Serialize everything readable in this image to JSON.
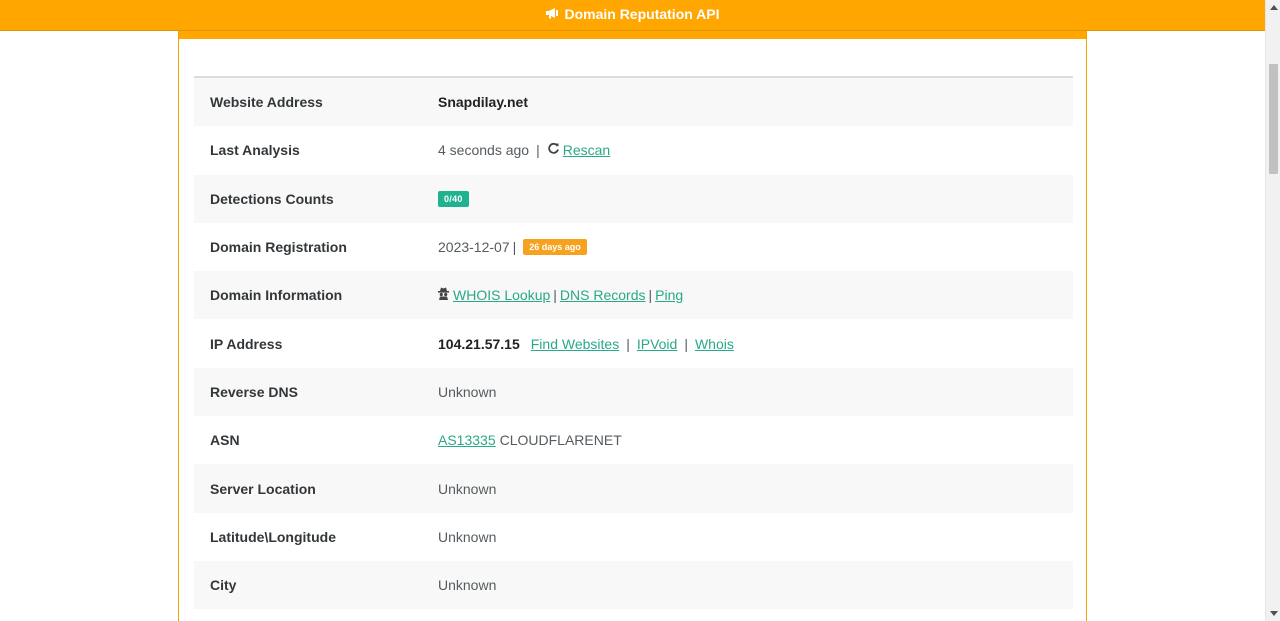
{
  "header": {
    "title": "Domain Reputation API",
    "icon": "megaphone-icon",
    "color": "#ffa600"
  },
  "rows": {
    "website_address": {
      "label": "Website Address",
      "value": "Snapdilay.net"
    },
    "last_analysis": {
      "label": "Last Analysis",
      "value": "4 seconds ago",
      "separator": "|",
      "rescan": "Rescan"
    },
    "detections": {
      "label": "Detections Counts",
      "badge": "0/40"
    },
    "registration": {
      "label": "Domain Registration",
      "date": "2023-12-07",
      "separator": "|",
      "badge": "26 days ago"
    },
    "information": {
      "label": "Domain Information",
      "whois": "WHOIS Lookup",
      "dns": "DNS Records",
      "ping": "Ping",
      "separator": "|"
    },
    "ip": {
      "label": "IP Address",
      "value": "104.21.57.15",
      "find": "Find Websites",
      "ipvoid": "IPVoid",
      "whois": "Whois",
      "separator": "|"
    },
    "reverse_dns": {
      "label": "Reverse DNS",
      "value": "Unknown"
    },
    "asn": {
      "label": "ASN",
      "link": "AS13335",
      "value": "CLOUDFLARENET"
    },
    "server_location": {
      "label": "Server Location",
      "value": "Unknown"
    },
    "latlon": {
      "label": "Latitude\\Longitude",
      "value": "Unknown"
    },
    "city": {
      "label": "City",
      "value": "Unknown"
    }
  },
  "colors": {
    "accent": "#ffa600",
    "link": "#2aa88a",
    "badge_green": "#1fb28e",
    "badge_orange": "#f6a21e"
  }
}
